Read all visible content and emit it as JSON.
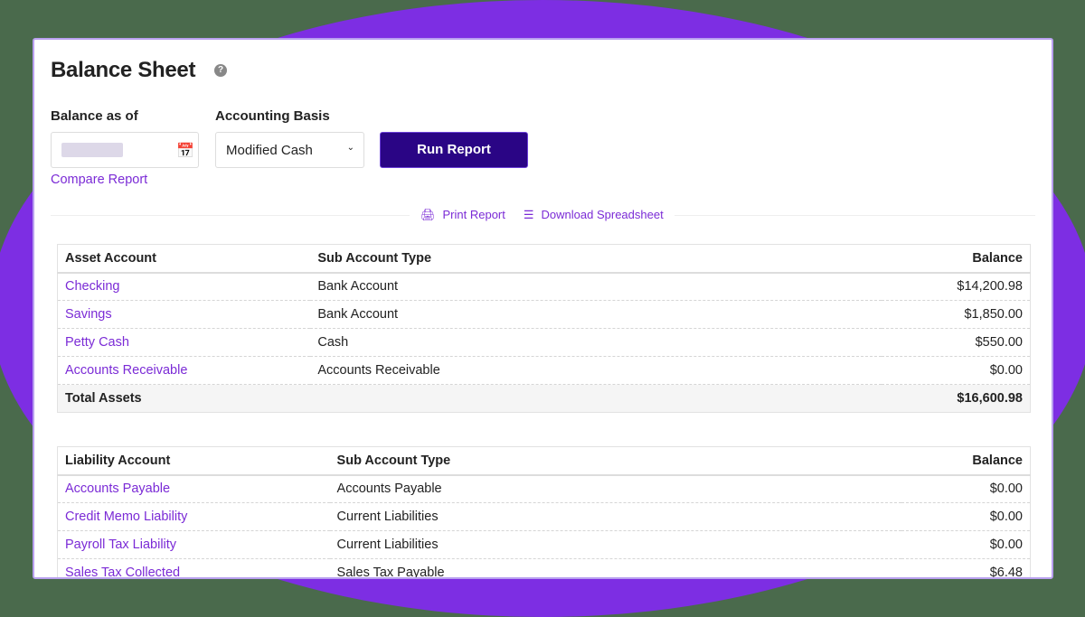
{
  "title": "Balance Sheet",
  "help_icon": "?",
  "balance_as_of_label": "Balance as of",
  "accounting_basis_label": "Accounting Basis",
  "accounting_basis_value": "Modified Cash",
  "run_report": "Run Report",
  "compare_report": "Compare Report",
  "print_report": "Print Report",
  "download_spreadsheet": "Download Spreadsheet",
  "assets": {
    "headers": [
      "Asset Account",
      "Sub Account Type",
      "Balance"
    ],
    "rows": [
      {
        "account": "Checking",
        "type": "Bank Account",
        "balance": "$14,200.98"
      },
      {
        "account": "Savings",
        "type": "Bank Account",
        "balance": "$1,850.00"
      },
      {
        "account": "Petty Cash",
        "type": "Cash",
        "balance": "$550.00"
      },
      {
        "account": "Accounts Receivable",
        "type": "Accounts Receivable",
        "balance": "$0.00"
      }
    ],
    "total_label": "Total Assets",
    "total": "$16,600.98"
  },
  "liabilities": {
    "headers": [
      "Liability Account",
      "Sub Account Type",
      "Balance"
    ],
    "rows": [
      {
        "account": "Accounts Payable",
        "type": "Accounts Payable",
        "balance": "$0.00"
      },
      {
        "account": "Credit Memo Liability",
        "type": "Current Liabilities",
        "balance": "$0.00"
      },
      {
        "account": "Payroll Tax Liability",
        "type": "Current Liabilities",
        "balance": "$0.00"
      },
      {
        "account": "Sales Tax Collected",
        "type": "Sales Tax Payable",
        "balance": "$6.48"
      }
    ]
  }
}
